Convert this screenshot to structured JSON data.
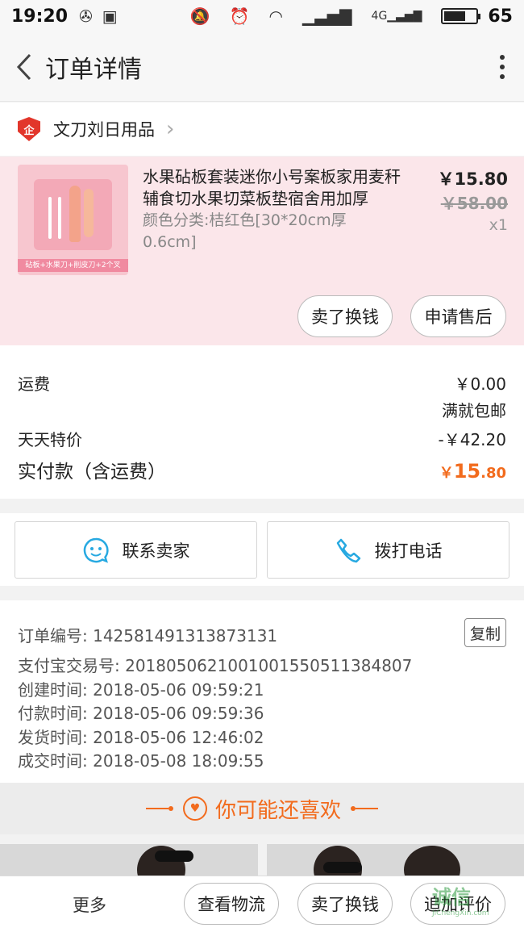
{
  "status_bar": {
    "time": "19:20",
    "icons": [
      "navigation-icon",
      "image-icon",
      "mute-icon",
      "alarm-icon",
      "wifi-icon",
      "signal-icon",
      "signal-4g-icon"
    ],
    "network": "4G",
    "battery_level": "65"
  },
  "navbar": {
    "back_icon": "chevron-left-icon",
    "title": "订单详情",
    "more_icon": "more-vertical-icon"
  },
  "shop": {
    "badge_text": "企",
    "name": "文刀刘日用品"
  },
  "product": {
    "title": "水果砧板套装迷你小号案板家用麦秆辅食切水果切菜板垫宿舍用加厚",
    "spec": "颜色分类:桔红色[30*20cm厚0.6cm]",
    "price": "￥15.80",
    "original_price": "￥58.00",
    "quantity": "x1",
    "thumb_caption": "砧板+水果刀+削皮刀+2个叉",
    "actions": [
      "卖了换钱",
      "申请售后"
    ]
  },
  "summary": {
    "shipping_label": "运费",
    "shipping_value": "￥0.00",
    "free_shipping_note": "满就包邮",
    "discount_label": "天天特价",
    "discount_value": "-￥42.20",
    "total_label": "实付款（含运费）",
    "total_currency": "￥",
    "total_int": "15",
    "total_dec": ".80",
    "accent_color": "#f26b1d"
  },
  "contact": {
    "seller_label": "联系卖家",
    "phone_label": "拨打电话"
  },
  "order_info": {
    "order_no": "订单编号: 142581491313873131",
    "copy_label": "复制",
    "alipay_no": "支付宝交易号: 2018050621001001550511384807",
    "created": "创建时间: 2018-05-06 09:59:21",
    "paid": "付款时间: 2018-05-06 09:59:36",
    "shipped": "发货时间: 2018-05-06 12:46:02",
    "completed": "成交时间: 2018-05-08 18:09:55"
  },
  "recommend": {
    "title": "你可能还喜欢"
  },
  "bottom_bar": {
    "more_label": "更多",
    "logistics_label": "查看物流",
    "sell_label": "卖了换钱",
    "review_label": "追加评价",
    "watermark_logo": "诚信",
    "watermark_url": "JiChengXin.com"
  }
}
